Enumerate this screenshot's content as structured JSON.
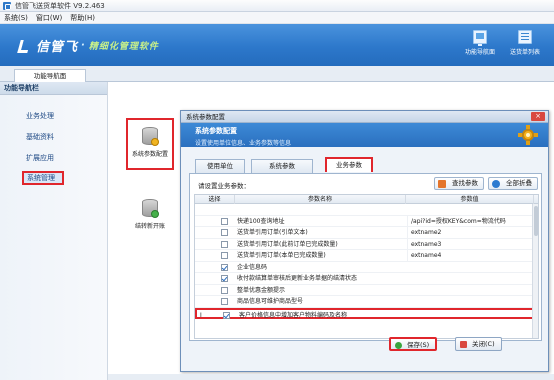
{
  "app": {
    "title": "信管飞送货单软件 V9.2.463",
    "menus": [
      "系统(S)",
      "窗口(W)",
      "帮助(H)"
    ]
  },
  "banner": {
    "logo_text": "信管飞",
    "dot": "·",
    "slogan": "精细化管理软件",
    "tools": [
      {
        "label": "功能导航面",
        "icon": "monitor-icon"
      },
      {
        "label": "送货单列表",
        "icon": "list-icon"
      }
    ]
  },
  "tabs": {
    "main_tab": "功能导航面"
  },
  "sidebar": {
    "header": "功能导航栏",
    "items": [
      "业务处理",
      "基础资料",
      "扩展应用",
      "系统管理"
    ],
    "active": "系统管理"
  },
  "desktop_icons": [
    {
      "label": "系统参数配置",
      "icon": "database-settings-icon"
    },
    {
      "label": "结转新开账",
      "icon": "database-refresh-icon"
    }
  ],
  "dialog": {
    "title": "系统参数配置",
    "close": "×",
    "header_title": "系统参数配置",
    "header_sub": "设置使用单位信息、业务参数等信息",
    "tabs": [
      "使用单位",
      "系统参数",
      "业务参数"
    ],
    "active_tab": "业务参数",
    "panel_label": "请设置业务参数：",
    "find_button": "查找参数",
    "expand_button": "全部折叠",
    "columns": [
      "选择",
      "参数名称",
      "参数值"
    ],
    "rows": [
      {
        "marker": "",
        "checked": false,
        "name": "",
        "value": ""
      },
      {
        "marker": "",
        "checked": false,
        "name": "快递100查询地址",
        "value": "/api?id=授权KEY&com=物流代码"
      },
      {
        "marker": "",
        "checked": false,
        "name": "送货单引用订单(引单文本)",
        "value": "extname2"
      },
      {
        "marker": "",
        "checked": false,
        "name": "送货单引用订单(此前订单已完成数量)",
        "value": "extname3"
      },
      {
        "marker": "",
        "checked": false,
        "name": "送货单引用订单(本单已完成数量)",
        "value": "extname4"
      },
      {
        "marker": "",
        "checked": true,
        "name": "企业信息码",
        "value": ""
      },
      {
        "marker": "",
        "checked": true,
        "name": "收付款结算单审核后更新业务单据的结清状态",
        "value": ""
      },
      {
        "marker": "",
        "checked": false,
        "name": "整单优惠金额提示",
        "value": ""
      },
      {
        "marker": "",
        "checked": false,
        "name": "商品信息可维护商品型号",
        "value": ""
      },
      {
        "marker": "I",
        "checked": true,
        "name": "客户价格信息中增加客户物料编码及名称",
        "value": ""
      }
    ],
    "save_button": "保存(S)",
    "close_button": "关闭(C)"
  },
  "colors": {
    "banner_blue": "#2d78cb",
    "highlight_red": "#e0262c",
    "slogan_green": "#c8f08a"
  }
}
